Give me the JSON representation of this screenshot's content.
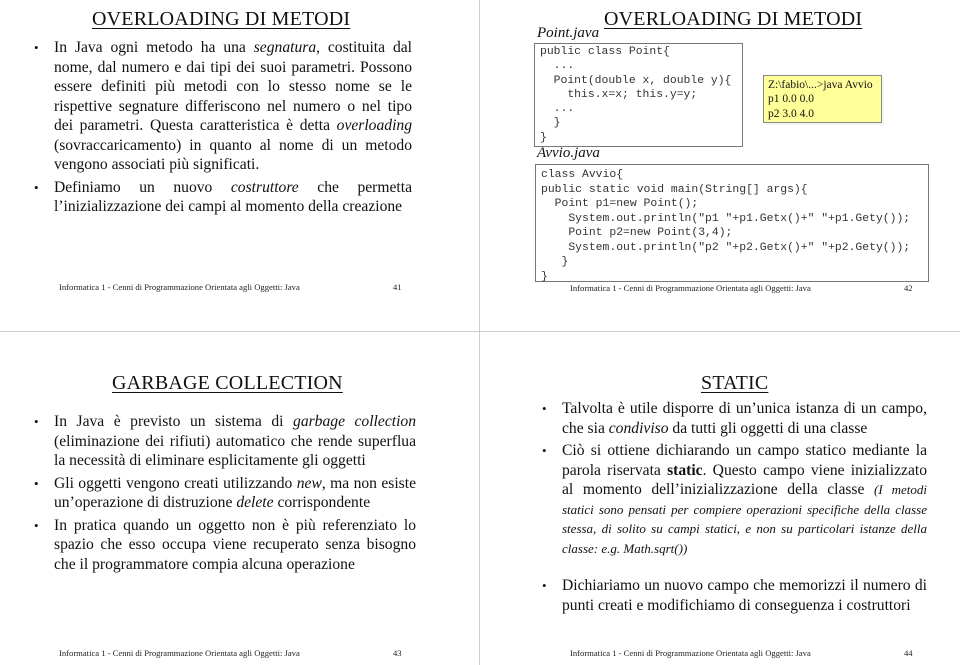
{
  "footer_text": "Informatica 1   -   Cenni di Programmazione Orientata agli Oggetti: Java",
  "slides": [
    {
      "title": "OVERLOADING  DI  METODI",
      "page": "41",
      "bullets": [
        {
          "parts": [
            {
              "t": "In Java ogni metodo ha una "
            },
            {
              "t": "segnatura",
              "i": true
            },
            {
              "t": ", costituita dal nome, dal numero e dai tipi dei suoi parametri. Possono essere definiti più metodi con lo stesso nome se le rispettive segnature differiscono nel numero o nel tipo dei parametri. Questa caratteristica è detta "
            },
            {
              "t": "overloading",
              "i": true
            },
            {
              "t": " (sovraccaricamento) in quanto al nome di un metodo vengono associati più significati."
            }
          ]
        },
        {
          "parts": [
            {
              "t": "Definiamo un nuovo "
            },
            {
              "t": "costruttore",
              "i": true
            },
            {
              "t": " che permetta l’inizializzazione dei campi al momento della creazione"
            }
          ]
        }
      ]
    },
    {
      "title": "OVERLOADING  DI  METODI",
      "page": "42",
      "file1": "Point.java",
      "code1": "public class Point{\n  ...\n  Point(double x, double y){\n    this.x=x; this.y=y;\n  ...\n  }\n}",
      "file2": "Avvio.java",
      "code2": "class Avvio{\npublic static void main(String[] args){\n  Point p1=new Point();\n    System.out.println(\"p1 \"+p1.Getx()+\" \"+p1.Gety());\n    Point p2=new Point(3,4);\n    System.out.println(\"p2 \"+p2.Getx()+\" \"+p2.Gety());\n   }\n}",
      "console": "Z:\\fabio\\...>java Avvio\np1 0.0 0.0\np2 3.0 4.0",
      "console_color": "#ffff99"
    },
    {
      "title": "GARBAGE COLLECTION",
      "page": "43",
      "bullets": [
        {
          "parts": [
            {
              "t": "In Java è previsto un sistema di "
            },
            {
              "t": "garbage collection",
              "i": true
            },
            {
              "t": " (eliminazione dei rifiuti) automatico che rende superflua la necessità  di eliminare esplicitamente gli oggetti"
            }
          ]
        },
        {
          "parts": [
            {
              "t": "Gli oggetti vengono creati utilizzando "
            },
            {
              "t": "new",
              "i": true
            },
            {
              "t": ", ma non esiste un’operazione di distruzione "
            },
            {
              "t": "delete",
              "i": true
            },
            {
              "t": " corrispondente"
            }
          ]
        },
        {
          "parts": [
            {
              "t": "In pratica quando un oggetto non è più referenziato lo spazio che esso occupa viene recuperato senza bisogno che il programmatore compia alcuna operazione"
            }
          ]
        }
      ]
    },
    {
      "title": "STATIC",
      "page": "44",
      "bullets": [
        {
          "parts": [
            {
              "t": "Talvolta è utile disporre di un’unica istanza di un campo, che sia "
            },
            {
              "t": "condiviso",
              "i": true
            },
            {
              "t": " da tutti gli oggetti di una classe"
            }
          ]
        },
        {
          "parts": [
            {
              "t": "Ciò  si ottiene dichiarando un campo statico mediante la parola riservata "
            },
            {
              "t": "static",
              "b": true
            },
            {
              "t": ".  Questo campo viene inizializzato al momento dell’inizializzazione della classe  "
            },
            {
              "t": "(I metodi statici sono pensati per compiere operazioni specifiche della classe stessa, di solito su campi statici, e non su particolari istanze della classe: e.g. Math.sqrt())",
              "i": true,
              "small": true
            }
          ]
        },
        {
          "parts": [
            {
              "t": "Dichiariamo un nuovo campo che memorizzi il numero di punti creati e modifichiamo di conseguenza i costruttori"
            }
          ]
        }
      ]
    }
  ]
}
